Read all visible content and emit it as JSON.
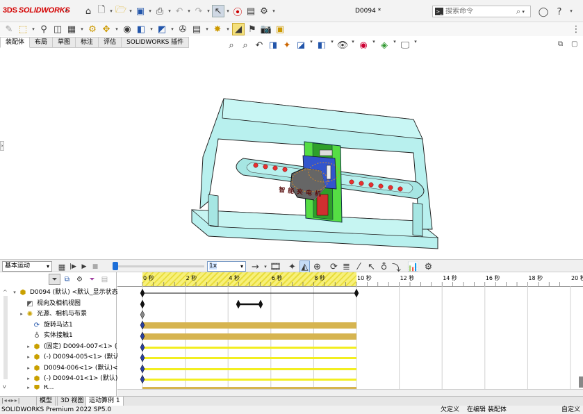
{
  "app": {
    "brand": "SOLIDWORKS",
    "brand_prefix": "3DS",
    "document_title": "D0094 *"
  },
  "search": {
    "placeholder": "搜索命令"
  },
  "command_tabs": [
    {
      "label": "装配体",
      "active": true
    },
    {
      "label": "布局",
      "active": false
    },
    {
      "label": "草图",
      "active": false
    },
    {
      "label": "标注",
      "active": false
    },
    {
      "label": "评估",
      "active": false
    },
    {
      "label": "SOLIDWORKS 插件",
      "active": false
    }
  ],
  "model": {
    "base_label": "智能夹电机",
    "colors": {
      "frame": "#b8f0ee",
      "carriage": "#55dd44",
      "motor": "#666666",
      "holes": "#e83030",
      "accent_blue": "#3355cc"
    }
  },
  "motion": {
    "study_type": "基本运动",
    "speed": "1x",
    "timeline_ticks": [
      "0 秒",
      "2 秒",
      "4 秒",
      "6 秒",
      "8 秒",
      "10 秒",
      "12 秒",
      "14 秒",
      "16 秒",
      "18 秒",
      "20 秒"
    ],
    "tree": [
      {
        "label": "D0094 (默认) <默认_显示状态",
        "icon": "assembly-icon",
        "expander": "▾"
      },
      {
        "label": "视向及相机视图",
        "icon": "camera-icon",
        "expander": ""
      },
      {
        "label": "光源、相机与布景",
        "icon": "light-icon",
        "expander": "▸"
      },
      {
        "label": "旋转马达1",
        "icon": "motor-icon",
        "expander": ""
      },
      {
        "label": "实体接触1",
        "icon": "contact-icon",
        "expander": ""
      },
      {
        "label": "(固定) D0094-007<1> (默",
        "icon": "part-icon",
        "expander": "▸"
      },
      {
        "label": "(-) D0094-005<1> (默认)",
        "icon": "part-icon",
        "expander": "▸"
      },
      {
        "label": "D0094-006<1> (默认)<",
        "icon": "part-icon",
        "expander": "▸"
      },
      {
        "label": "(-) D0094-01<1> (默认)",
        "icon": "part-icon",
        "expander": "▸"
      },
      {
        "label": "R...",
        "icon": "part-icon",
        "expander": "▸"
      }
    ]
  },
  "bottom_tabs": [
    {
      "label": "模型",
      "active": false
    },
    {
      "label": "3D 视图",
      "active": false
    },
    {
      "label": "运动算例 1",
      "active": true
    }
  ],
  "status": {
    "product": "SOLIDWORKS Premium 2022 SP5.0",
    "definition": "欠定义",
    "editing": "在编辑 装配体",
    "custom": "自定义"
  }
}
